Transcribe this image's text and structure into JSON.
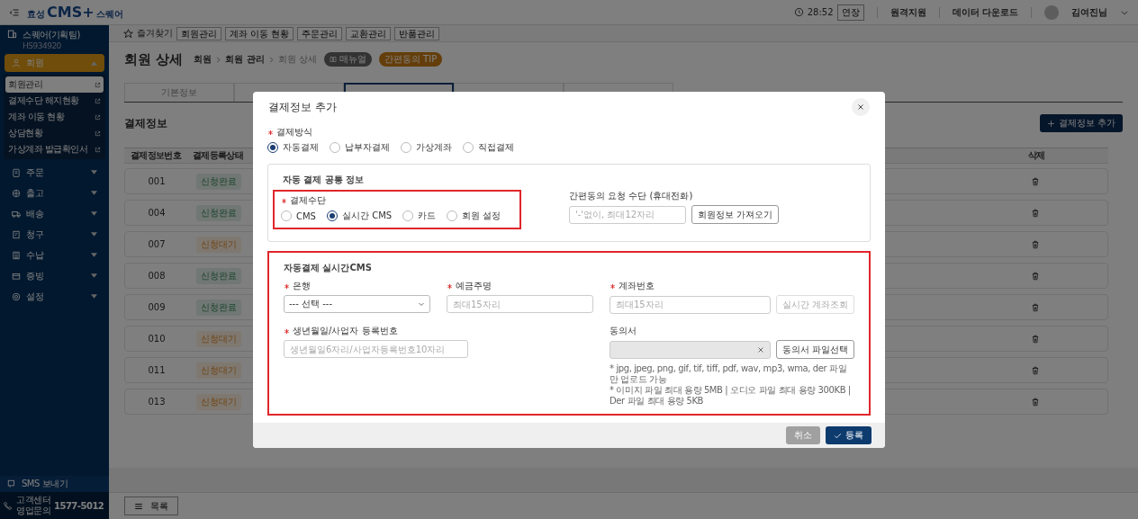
{
  "header": {
    "logo": {
      "prefix": "효성",
      "main": "CMS+",
      "suffix": "스퀘어"
    },
    "time": "28:52",
    "extend_button": "연장",
    "links": [
      "원격지원",
      "데이터 다운로드"
    ],
    "user": "김여진님"
  },
  "sidebar": {
    "org_name": "스퀘어(기획팀)",
    "org_code": "HS934920",
    "menus": [
      {
        "label": "회원",
        "selected": true,
        "expanded": true,
        "children": [
          {
            "label": "회원관리",
            "selected": true
          },
          {
            "label": "결제수단 해지현황",
            "selected": false
          },
          {
            "label": "계좌 이동 현황",
            "selected": false
          },
          {
            "label": "상담현황",
            "selected": false
          },
          {
            "label": "가상계좌 발급확인서",
            "selected": false
          }
        ]
      },
      {
        "label": "주문",
        "selected": false,
        "expanded": false
      },
      {
        "label": "출고",
        "selected": false,
        "expanded": false
      },
      {
        "label": "배송",
        "selected": false,
        "expanded": false
      },
      {
        "label": "청구",
        "selected": false,
        "expanded": false
      },
      {
        "label": "수납",
        "selected": false,
        "expanded": false
      },
      {
        "label": "증빙",
        "selected": false,
        "expanded": false
      },
      {
        "label": "설정",
        "selected": false,
        "expanded": false
      }
    ],
    "sms": "SMS 보내기",
    "support": {
      "lines": [
        "고객센터",
        "영업문의"
      ],
      "phone": "1577-5012"
    }
  },
  "favorites": {
    "label": "즐겨찾기",
    "items": [
      "회원관리",
      "계좌 이동 현황",
      "주문관리",
      "교환관리",
      "반품관리"
    ]
  },
  "page": {
    "title": "회원 상세",
    "breadcrumb": [
      "회원",
      "회원 관리",
      "회원 상세"
    ],
    "manual_badge": "매뉴얼",
    "tip_badge": "간편동의 TIP"
  },
  "tabs": [
    {
      "label": "기본정보",
      "selected": false
    },
    {
      "selected": false
    },
    {
      "selected": true
    },
    {
      "selected": false
    },
    {
      "selected": false
    }
  ],
  "section": {
    "title": "결제정보",
    "add_button": "결제정보 추가"
  },
  "table": {
    "columns": [
      "결제정보번호",
      "결제등록상태",
      "삭제"
    ],
    "rows": [
      {
        "number": "001",
        "status": "신청완료",
        "kind": "done"
      },
      {
        "number": "004",
        "status": "신청완료",
        "kind": "done"
      },
      {
        "number": "007",
        "status": "신청대기",
        "kind": "waiting"
      },
      {
        "number": "008",
        "status": "신청완료",
        "kind": "done"
      },
      {
        "number": "009",
        "status": "신청완료",
        "kind": "done"
      },
      {
        "number": "010",
        "status": "신청대기",
        "kind": "waiting"
      },
      {
        "number": "011",
        "status": "신청대기",
        "kind": "waiting"
      },
      {
        "number": "013",
        "status": "신청대기",
        "kind": "waiting"
      }
    ]
  },
  "bottom_bar": {
    "list_button": "목록"
  },
  "modal": {
    "title": "결제정보 추가",
    "method": {
      "label": "결제방식",
      "required": true,
      "options": [
        {
          "label": "자동결제",
          "selected": true
        },
        {
          "label": "납부자결제",
          "selected": false
        },
        {
          "label": "가상계좌",
          "selected": false
        },
        {
          "label": "직접결제",
          "selected": false
        }
      ]
    },
    "common_box": {
      "title": "자동 결제 공통 정보",
      "means": {
        "label": "결제수단",
        "required": true,
        "highlighted": true,
        "options": [
          {
            "label": "CMS",
            "selected": false
          },
          {
            "label": "실시간 CMS",
            "selected": true
          },
          {
            "label": "카드",
            "selected": false
          },
          {
            "label": "회원 설정",
            "selected": false
          }
        ]
      },
      "consent_request": {
        "label": "간편동의 요청 수단 (휴대전화)",
        "required": false,
        "placeholder": "'-'없이, 최대12자리",
        "button": "회원정보 가져오기"
      }
    },
    "cms_box": {
      "title": "자동결제 실시간CMS",
      "highlighted": true,
      "bank": {
        "label": "은행",
        "required": true,
        "value": "--- 선택 ---"
      },
      "holder": {
        "label": "예금주명",
        "required": true,
        "placeholder": "최대15자리"
      },
      "account": {
        "label": "계좌번호",
        "required": true,
        "placeholder": "최대15자리",
        "button": "실시간 계좌조회",
        "button_disabled": true
      },
      "birth": {
        "label": "생년월일/사업자 등록번호",
        "required": true,
        "placeholder": "생년월일6자리/사업자등록번호10자리"
      },
      "consent": {
        "label": "동의서",
        "required": false,
        "button": "동의서 파일선택",
        "notes": [
          "* jpg, jpeg, png, gif, tif, tiff, pdf, wav, mp3, wma, der 파일만 업로드 가능",
          "* 이미지 파일 최대 용량 5MB | 오디오 파일 최대 용량 300KB | Der 파일 최대 용량 5KB"
        ]
      }
    },
    "buttons": {
      "cancel": "취소",
      "submit": "등록"
    }
  }
}
